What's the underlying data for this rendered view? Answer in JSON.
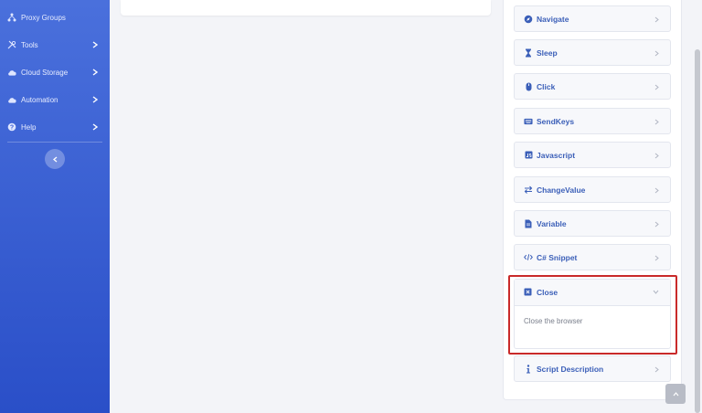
{
  "sidebar": {
    "items": [
      {
        "label": "Proxy Groups",
        "icon": "network-icon",
        "chevron": false
      },
      {
        "label": "Tools",
        "icon": "tools-icon",
        "chevron": true
      },
      {
        "label": "Cloud Storage",
        "icon": "cloud-icon",
        "chevron": true
      },
      {
        "label": "Automation",
        "icon": "robot-icon",
        "chevron": true
      },
      {
        "label": "Help",
        "icon": "help-icon",
        "chevron": true
      }
    ]
  },
  "actions": [
    {
      "label": "Navigate",
      "icon": "compass-icon"
    },
    {
      "label": "Sleep",
      "icon": "hourglass-icon"
    },
    {
      "label": "Click",
      "icon": "mouse-icon"
    },
    {
      "label": "SendKeys",
      "icon": "keyboard-icon"
    },
    {
      "label": "Javascript",
      "icon": "js-icon"
    },
    {
      "label": "ChangeValue",
      "icon": "swap-icon"
    },
    {
      "label": "Variable",
      "icon": "file-icon"
    },
    {
      "label": "C# Snippet",
      "icon": "code-icon"
    }
  ],
  "expanded_action": {
    "label": "Close",
    "icon": "close-square-icon",
    "description": "Close the browser"
  },
  "last_action": {
    "label": "Script Description",
    "icon": "info-icon"
  },
  "colors": {
    "accent": "#3b5fb8",
    "sidebar": "#3b5fd6",
    "highlight": "#c92a2a"
  }
}
